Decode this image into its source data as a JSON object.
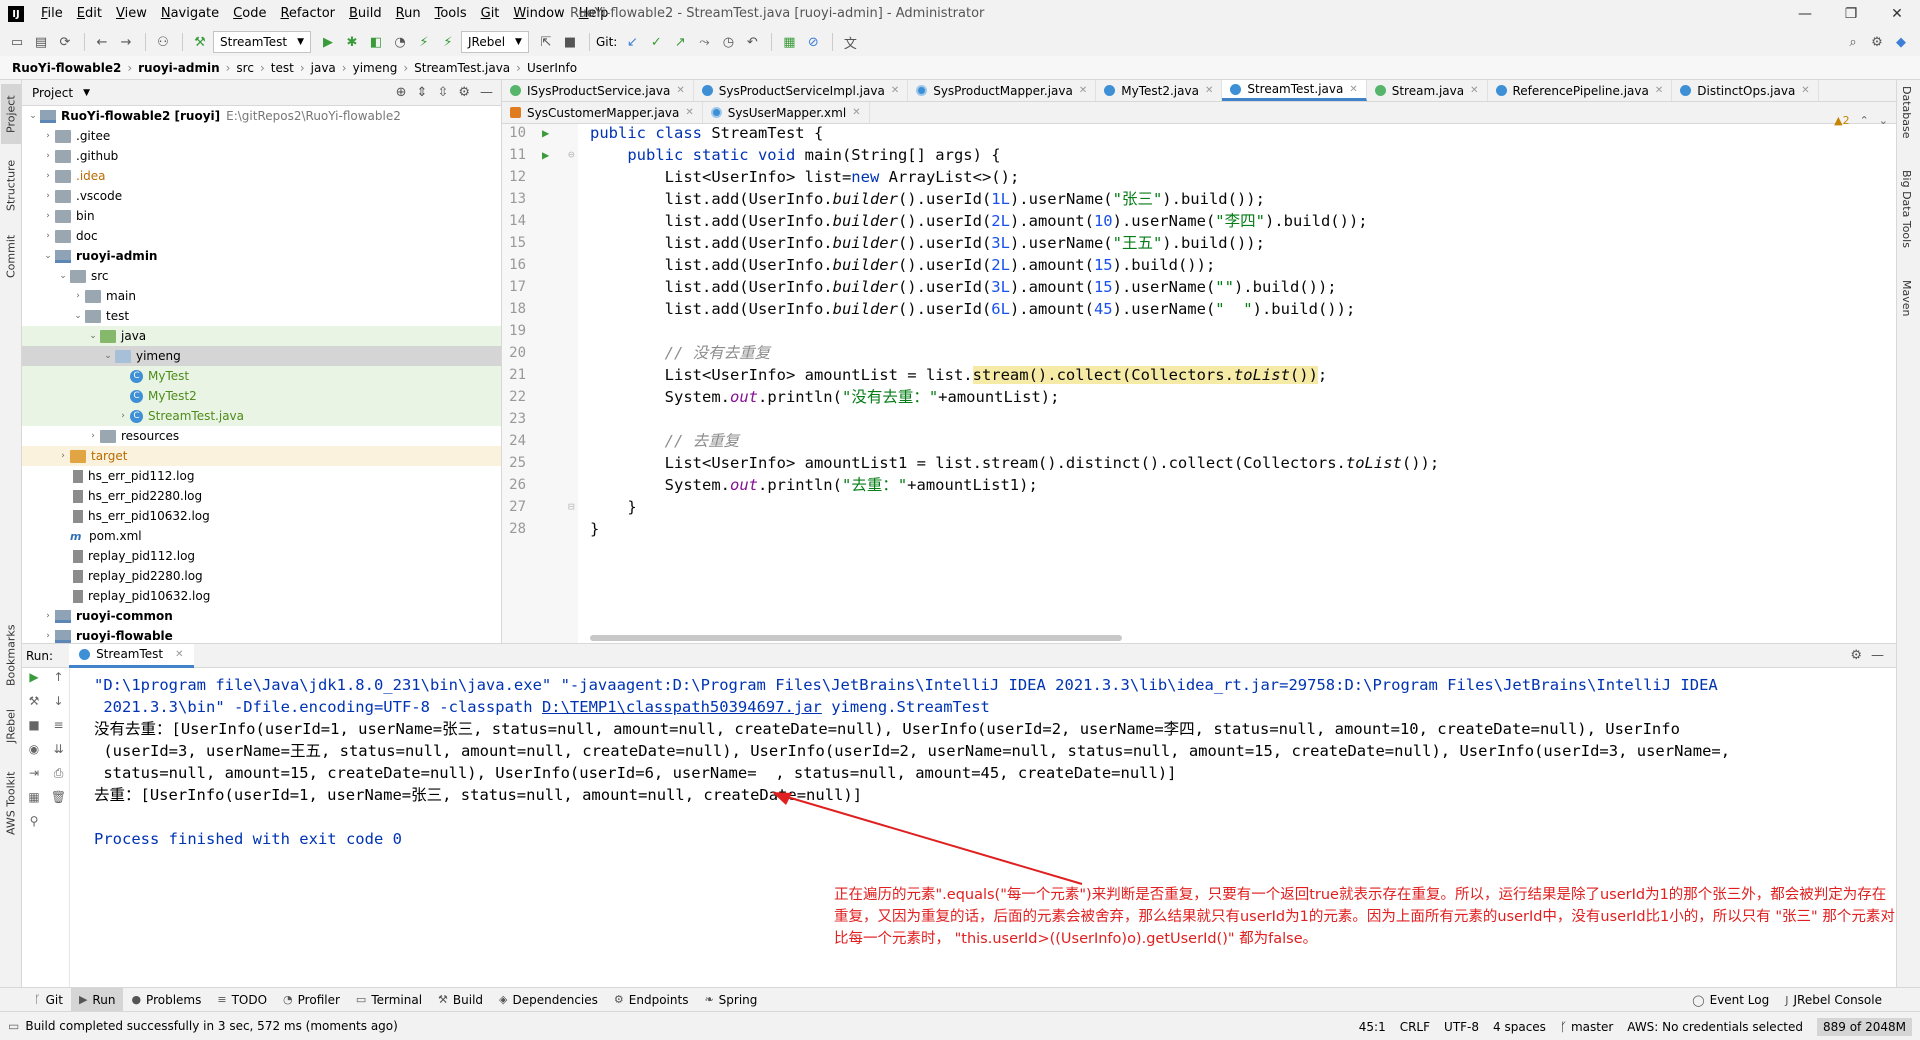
{
  "menu": [
    "File",
    "Edit",
    "View",
    "Navigate",
    "Code",
    "Refactor",
    "Build",
    "Run",
    "Tools",
    "Git",
    "Window",
    "Help"
  ],
  "window_title": "RuoYi-flowable2 - StreamTest.java [ruoyi-admin] - Administrator",
  "toolbar": {
    "run_config": "StreamTest",
    "jrebel": "JRebel",
    "git_label": "Git:"
  },
  "breadcrumb": [
    "RuoYi-flowable2",
    "ruoyi-admin",
    "src",
    "test",
    "java",
    "yimeng",
    "StreamTest.java",
    "UserInfo"
  ],
  "left_strip": [
    "Project",
    "Structure",
    "Commit",
    "Bookmarks",
    "JRebel",
    "AWS Toolkit"
  ],
  "right_strip": [
    "Database",
    "Big Data Tools",
    "Maven"
  ],
  "project": {
    "title": "Project",
    "tree": [
      {
        "label": "RuoYi-flowable2 [ruoyi]",
        "extra": "E:\\gitRepos2\\RuoYi-flowable2",
        "depth": 0,
        "arrow": "v",
        "icon": "module",
        "bold": true
      },
      {
        "label": ".gitee",
        "depth": 1,
        "arrow": ">",
        "icon": "folder"
      },
      {
        "label": ".github",
        "depth": 1,
        "arrow": ">",
        "icon": "folder"
      },
      {
        "label": ".idea",
        "depth": 1,
        "arrow": ">",
        "icon": "folder",
        "color": "orange"
      },
      {
        "label": ".vscode",
        "depth": 1,
        "arrow": ">",
        "icon": "folder"
      },
      {
        "label": "bin",
        "depth": 1,
        "arrow": ">",
        "icon": "folder"
      },
      {
        "label": "doc",
        "depth": 1,
        "arrow": ">",
        "icon": "folder"
      },
      {
        "label": "ruoyi-admin",
        "depth": 1,
        "arrow": "v",
        "icon": "module",
        "bold": true
      },
      {
        "label": "src",
        "depth": 2,
        "arrow": "v",
        "icon": "folder"
      },
      {
        "label": "main",
        "depth": 3,
        "arrow": ">",
        "icon": "folder"
      },
      {
        "label": "test",
        "depth": 3,
        "arrow": "v",
        "icon": "folder"
      },
      {
        "label": "java",
        "depth": 4,
        "arrow": "v",
        "icon": "folder-green",
        "row": "green"
      },
      {
        "label": "yimeng",
        "depth": 5,
        "arrow": "v",
        "icon": "folder-blue",
        "row": "sel"
      },
      {
        "label": "MyTest",
        "depth": 6,
        "arrow": "",
        "icon": "class",
        "color": "green",
        "row": "green"
      },
      {
        "label": "MyTest2",
        "depth": 6,
        "arrow": "",
        "icon": "class",
        "color": "green",
        "row": "green"
      },
      {
        "label": "StreamTest.java",
        "depth": 6,
        "arrow": ">",
        "icon": "class",
        "color": "green",
        "row": "green"
      },
      {
        "label": "resources",
        "depth": 4,
        "arrow": ">",
        "icon": "folder"
      },
      {
        "label": "target",
        "depth": 2,
        "arrow": ">",
        "icon": "folder-orange",
        "color": "orange",
        "row": "orange"
      },
      {
        "label": "hs_err_pid112.log",
        "depth": 2,
        "arrow": "",
        "icon": "file"
      },
      {
        "label": "hs_err_pid2280.log",
        "depth": 2,
        "arrow": "",
        "icon": "file"
      },
      {
        "label": "hs_err_pid10632.log",
        "depth": 2,
        "arrow": "",
        "icon": "file"
      },
      {
        "label": "pom.xml",
        "depth": 2,
        "arrow": "",
        "icon": "maven"
      },
      {
        "label": "replay_pid112.log",
        "depth": 2,
        "arrow": "",
        "icon": "file"
      },
      {
        "label": "replay_pid2280.log",
        "depth": 2,
        "arrow": "",
        "icon": "file"
      },
      {
        "label": "replay_pid10632.log",
        "depth": 2,
        "arrow": "",
        "icon": "file"
      },
      {
        "label": "ruoyi-common",
        "depth": 1,
        "arrow": ">",
        "icon": "module",
        "bold": true
      },
      {
        "label": "ruoyi-flowable",
        "depth": 1,
        "arrow": ">",
        "icon": "module",
        "bold": true
      }
    ]
  },
  "editor": {
    "tabs_row1": [
      {
        "label": "ISysProductService.java",
        "icon": "i"
      },
      {
        "label": "SysProductServiceImpl.java",
        "icon": "c"
      },
      {
        "label": "SysProductMapper.java",
        "icon": "m"
      },
      {
        "label": "MyTest2.java",
        "icon": "c"
      },
      {
        "label": "StreamTest.java",
        "icon": "c",
        "active": true
      },
      {
        "label": "Stream.java",
        "icon": "i"
      },
      {
        "label": "ReferencePipeline.java",
        "icon": "c"
      },
      {
        "label": "DistinctOps.java",
        "icon": "c"
      }
    ],
    "tabs_row2": [
      {
        "label": "SysCustomerMapper.java",
        "icon": "x"
      },
      {
        "label": "SysUserMapper.xml",
        "icon": "m"
      }
    ],
    "inspection": {
      "warnings": "2"
    },
    "lines": [
      {
        "n": "10",
        "run": true,
        "html": "<span class=\"kw\">public class</span> StreamTest {"
      },
      {
        "n": "11",
        "run": true,
        "html": "    <span class=\"kw\">public static void</span> main(String[] args) {"
      },
      {
        "n": "12",
        "html": "        List&lt;UserInfo&gt; list=<span class=\"kw\">new</span> ArrayList&lt;&gt;();"
      },
      {
        "n": "13",
        "html": "        list.add(UserInfo.<span class=\"it\">builder</span>().userId(<span class=\"num\">1L</span>).userName(<span class=\"str\">\"张三\"</span>).build());"
      },
      {
        "n": "14",
        "html": "        list.add(UserInfo.<span class=\"it\">builder</span>().userId(<span class=\"num\">2L</span>).amount(<span class=\"num\">10</span>).userName(<span class=\"str\">\"李四\"</span>).build());"
      },
      {
        "n": "15",
        "html": "        list.add(UserInfo.<span class=\"it\">builder</span>().userId(<span class=\"num\">3L</span>).userName(<span class=\"str\">\"王五\"</span>).build());"
      },
      {
        "n": "16",
        "html": "        list.add(UserInfo.<span class=\"it\">builder</span>().userId(<span class=\"num\">2L</span>).amount(<span class=\"num\">15</span>).build());"
      },
      {
        "n": "17",
        "html": "        list.add(UserInfo.<span class=\"it\">builder</span>().userId(<span class=\"num\">3L</span>).amount(<span class=\"num\">15</span>).userName(<span class=\"str\">\"\"</span>).build());"
      },
      {
        "n": "18",
        "html": "        list.add(UserInfo.<span class=\"it\">builder</span>().userId(<span class=\"num\">6L</span>).amount(<span class=\"num\">45</span>).userName(<span class=\"str\">\"  \"</span>).build());"
      },
      {
        "n": "19",
        "html": ""
      },
      {
        "n": "20",
        "html": "        <span class=\"cmt\">// 没有去重复</span>"
      },
      {
        "n": "21",
        "html": "        List&lt;UserInfo&gt; amountList = list.<span class=\"hl\">stream().collect(Collectors.<span class=\"it\">toList</span>())</span>;"
      },
      {
        "n": "22",
        "html": "        System.<span class=\"fld\">out</span>.println(<span class=\"str\">\"没有去重：\"</span>+amountList);"
      },
      {
        "n": "23",
        "html": ""
      },
      {
        "n": "24",
        "html": "        <span class=\"cmt\">// 去重复</span>"
      },
      {
        "n": "25",
        "html": "        List&lt;UserInfo&gt; amountList1 = list.stream().distinct().collect(Collectors.<span class=\"it\">toList</span>());"
      },
      {
        "n": "26",
        "html": "        System.<span class=\"fld\">out</span>.println(<span class=\"str\">\"去重：\"</span>+amountList1);"
      },
      {
        "n": "27",
        "html": "    }"
      },
      {
        "n": "28",
        "html": "}"
      }
    ]
  },
  "run": {
    "label": "Run:",
    "tab": "StreamTest",
    "console_cmd_1": "\"D:\\1program file\\Java\\jdk1.8.0_231\\bin\\java.exe\" \"-javaagent:D:\\Program Files\\JetBrains\\IntelliJ IDEA 2021.3.3\\lib\\idea_rt.jar=29758:D:\\Program Files\\JetBrains\\IntelliJ IDEA",
    "console_cmd_2a": " 2021.3.3\\bin\" -Dfile.encoding=UTF-8 -classpath ",
    "console_cmd_link": "D:\\TEMP1\\classpath50394697.jar",
    "console_cmd_2b": " yimeng.StreamTest",
    "out_1": "没有去重：[UserInfo(userId=1, userName=张三, status=null, amount=null, createDate=null), UserInfo(userId=2, userName=李四, status=null, amount=10, createDate=null), UserInfo",
    "out_2": " (userId=3, userName=王五, status=null, amount=null, createDate=null), UserInfo(userId=2, userName=null, status=null, amount=15, createDate=null), UserInfo(userId=3, userName=,",
    "out_3": " status=null, amount=15, createDate=null), UserInfo(userId=6, userName=  , status=null, amount=45, createDate=null)]",
    "out_4": "去重：[UserInfo(userId=1, userName=张三, status=null, amount=null, createDate=null)]",
    "finished": "Process finished with exit code 0",
    "annotation": "正在遍历的元素\".equals(\"每一个元素\")来判断是否重复，只要有一个返回true就表示存在重复。所以，运行结果是除了userId为1的那个张三外，都会被判定为存在重复，又因为重复的话，后面的元素会被舍弃，那么结果就只有userId为1的元素。因为上面所有元素的userId中，没有userId比1小的，所以只有 \"张三\" 那个元素对比每一个元素时， \"this.userId>((UserInfo)o).getUserId()\" 都为false。"
  },
  "bottom_tools": [
    {
      "label": "Git",
      "icon": "ᚴ"
    },
    {
      "label": "Run",
      "icon": "▶",
      "active": true
    },
    {
      "label": "Problems",
      "icon": "●"
    },
    {
      "label": "TODO",
      "icon": "≡"
    },
    {
      "label": "Profiler",
      "icon": "◔"
    },
    {
      "label": "Terminal",
      "icon": "▭"
    },
    {
      "label": "Build",
      "icon": "⚒"
    },
    {
      "label": "Dependencies",
      "icon": "◈"
    },
    {
      "label": "Endpoints",
      "icon": "⚙"
    },
    {
      "label": "Spring",
      "icon": "❧"
    }
  ],
  "bottom_right": [
    {
      "label": "Event Log",
      "icon": "◯"
    },
    {
      "label": "JRebel Console",
      "icon": "J"
    }
  ],
  "status": {
    "message": "Build completed successfully in 3 sec, 572 ms (moments ago)",
    "position": "45:1",
    "line_sep": "CRLF",
    "encoding": "UTF-8",
    "indent": "4 spaces",
    "branch": "master",
    "aws": "AWS: No credentials selected",
    "memory": "889 of 2048M"
  }
}
